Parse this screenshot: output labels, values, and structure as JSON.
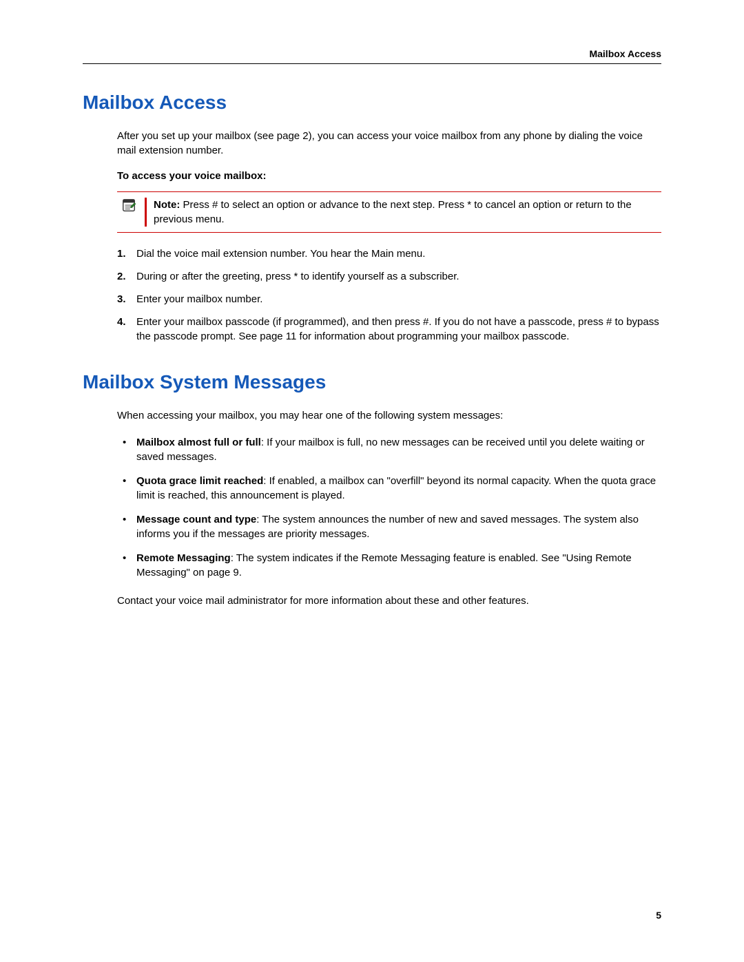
{
  "header": {
    "running_title": "Mailbox Access"
  },
  "section1": {
    "title": "Mailbox Access",
    "intro": "After you set up your mailbox (see page 2), you can access your voice mailbox from any phone by dialing the voice mail extension number.",
    "subhead": "To access your voice mailbox:",
    "note": {
      "label": "Note: ",
      "text": "Press # to select an option or advance to the next step. Press * to cancel an option or return to the previous menu."
    },
    "steps": [
      "Dial the voice mail extension number. You hear the Main menu.",
      "During or after the greeting, press * to identify yourself as a subscriber.",
      "Enter your mailbox number.",
      "Enter your mailbox passcode (if programmed), and then press #. If you do not have a passcode, press # to bypass the passcode prompt. See page 11 for information about programming your mailbox passcode."
    ]
  },
  "section2": {
    "title": "Mailbox System Messages",
    "intro": "When accessing your mailbox, you may hear one of the following system messages:",
    "bullets": [
      {
        "term": "Mailbox almost full or full",
        "desc": ": If your mailbox is full, no new messages can be received until you delete waiting or saved messages."
      },
      {
        "term": "Quota grace limit reached",
        "desc": ": If enabled, a mailbox can \"overfill\" beyond its normal capacity. When the quota grace limit is reached, this announcement is played."
      },
      {
        "term": "Message count and type",
        "desc": ": The system announces the number of new and saved messages. The system also informs you if the messages are priority messages."
      },
      {
        "term": "Remote Messaging",
        "desc": ": The system indicates if the Remote Messaging feature is enabled. See \"Using Remote Messaging\" on page 9."
      }
    ],
    "outro": "Contact your voice mail administrator for more information about these and other features."
  },
  "footer": {
    "page_number": "5"
  }
}
